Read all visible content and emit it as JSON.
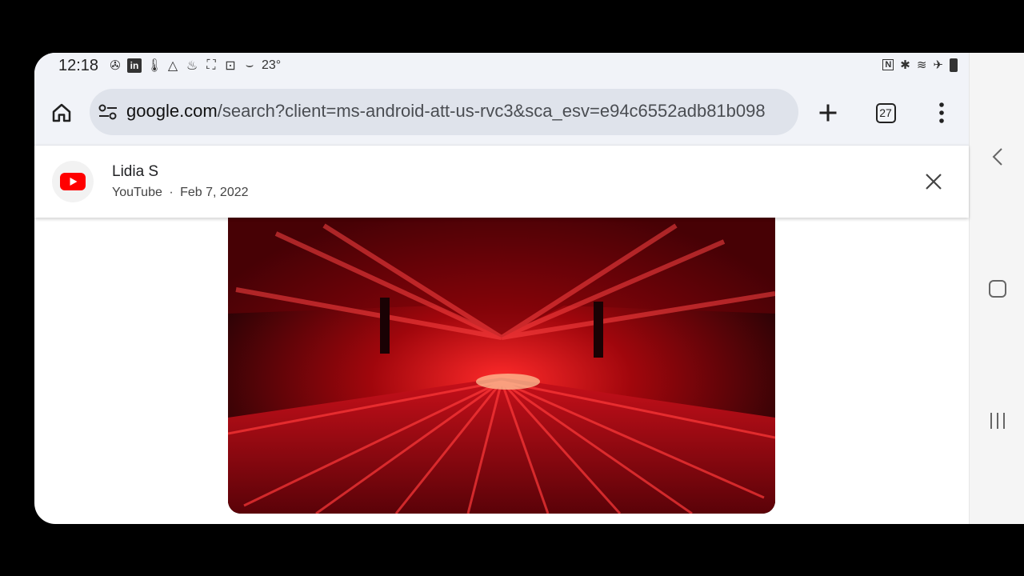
{
  "status_bar": {
    "time": "12:18",
    "temperature": "23°",
    "left_icons": [
      "fan-icon",
      "linkedin-icon",
      "thermometer-icon",
      "drive-icon",
      "cleaning-icon",
      "screenshot-icon",
      "scan-icon",
      "amazon-icon"
    ],
    "right_icons": [
      "nfc-icon",
      "bluetooth-icon",
      "wifi-icon",
      "airplane-icon",
      "battery-icon"
    ]
  },
  "browser": {
    "url_host": "google.com",
    "url_path": "/search?client=ms-android-att-us-rvc3&sca_esv=e94c6552adb81b098",
    "tab_count": "27"
  },
  "video_card": {
    "channel": "Lidia S",
    "source": "YouTube",
    "separator": "·",
    "date": "Feb 7, 2022"
  },
  "colors": {
    "youtube_red": "#ff0000",
    "toolbar_bg": "#f1f3f8",
    "url_bg": "#dfe3eb"
  }
}
